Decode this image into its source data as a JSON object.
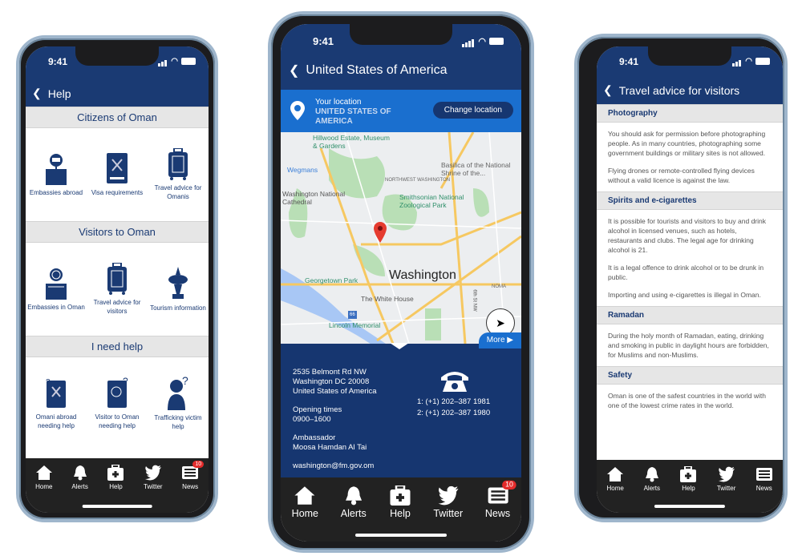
{
  "status": {
    "time": "9:41"
  },
  "colors": {
    "header": "#1a3a73",
    "location_bar": "#1a6fcf",
    "info_panel": "#163670",
    "tabbar": "#222222",
    "badge": "#e42b2b"
  },
  "tabs": [
    {
      "label": "Home",
      "icon": "home-icon"
    },
    {
      "label": "Alerts",
      "icon": "bell-icon"
    },
    {
      "label": "Help",
      "icon": "medical-kit-icon"
    },
    {
      "label": "Twitter",
      "icon": "twitter-icon"
    },
    {
      "label": "News",
      "icon": "newspaper-icon",
      "badge": "10"
    }
  ],
  "help": {
    "title": "Help",
    "sections": [
      {
        "title": "Citizens of Oman",
        "items": [
          {
            "label": "Embassies abroad",
            "icon": "embassy-map-icon"
          },
          {
            "label": "Visa requirements",
            "icon": "passport-icon"
          },
          {
            "label": "Travel advice for Omanis",
            "icon": "suitcase-icon"
          }
        ]
      },
      {
        "title": "Visitors to Oman",
        "items": [
          {
            "label": "Embassies in Oman",
            "icon": "globe-map-icon"
          },
          {
            "label": "Travel advice for visitors",
            "icon": "suitcase-icon"
          },
          {
            "label": "Tourism information",
            "icon": "incense-burner-icon"
          }
        ]
      },
      {
        "title": "I need help",
        "items": [
          {
            "label": "Omani abroad needing help",
            "icon": "passport-question-icon"
          },
          {
            "label": "Visitor to Oman needing help",
            "icon": "passport-globe-question-icon"
          },
          {
            "label": "Trafficking victim help",
            "icon": "person-question-icon"
          }
        ]
      }
    ]
  },
  "embassy": {
    "title": "United States of America",
    "location_label": "Your location",
    "location_value": "UNITED STATES OF AMERICA",
    "change_location": "Change location",
    "map": {
      "city": "Washington",
      "labels": [
        "Hillwood Estate, Museum & Gardens",
        "Wegmans",
        "NORTHWEST WASHINGTON",
        "Washington National Cathedral",
        "Smithsonian National Zoological Park",
        "Basilica of the National Shrine of the...",
        "Georgetown Park",
        "The White House",
        "NOMA",
        "Lincoln Memorial",
        "6th St NW",
        "CAPITOL",
        "66"
      ]
    },
    "more": "More ▶",
    "address": [
      "2535 Belmont Rd NW",
      "Washington DC 20008",
      "United States of America"
    ],
    "opening_label": "Opening times",
    "opening_value": "0900–1600",
    "ambassador_label": "Ambassador",
    "ambassador_name": "Moosa Hamdan Al Tai",
    "email": "washington@fm.gov.om",
    "phones": [
      "1: (+1) 202–387 1981",
      "2: (+1) 202–387 1980"
    ]
  },
  "advice": {
    "title": "Travel advice for visitors",
    "sections": [
      {
        "title": "Photography",
        "paragraphs": [
          "You should ask for permission before photographing people. As in many countries, photographing some government buildings or military sites is not allowed.",
          "Flying drones or remote-controlled flying devices without a valid licence is against the law."
        ]
      },
      {
        "title": "Spirits and e-cigarettes",
        "paragraphs": [
          "It is possible for tourists and visitors to buy and drink alcohol in licensed venues, such as hotels, restaurants and clubs. The legal age for drinking alcohol is 21.",
          "It is a legal offence to drink alcohol or to be drunk in public.",
          "Importing and using e-cigarettes is illegal in Oman."
        ]
      },
      {
        "title": "Ramadan",
        "paragraphs": [
          "During the holy month of Ramadan, eating, drinking and smoking in public in daylight hours are forbidden, for Muslims and non-Muslims."
        ]
      },
      {
        "title": "Safety",
        "paragraphs": [
          "Oman is one of the safest countries in the world with one of the lowest crime rates in the world."
        ]
      }
    ]
  }
}
